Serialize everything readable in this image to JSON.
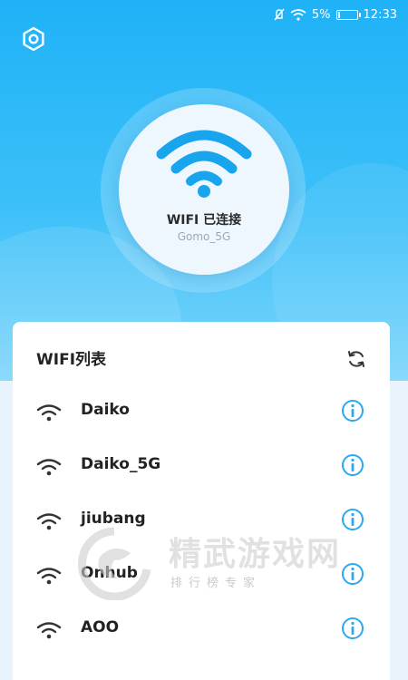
{
  "status_bar": {
    "battery": "5%",
    "time": "12:33",
    "battery_level": 0.05
  },
  "connection": {
    "status": "WIFI 已连接",
    "ssid": "Gomo_5G"
  },
  "list": {
    "title": "WIFI列表",
    "networks": [
      {
        "name": "Daiko"
      },
      {
        "name": "Daiko_5G"
      },
      {
        "name": "jiubang"
      },
      {
        "name": "Onhub"
      },
      {
        "name": "AOO"
      }
    ]
  },
  "watermark": {
    "title": "精武游戏网",
    "subtitle": "排行榜专家"
  },
  "icons": {
    "settings": "settings-hexagon-icon",
    "refresh": "refresh-icon",
    "wifi": "wifi-icon",
    "info": "info-icon"
  },
  "colors": {
    "accent": "#1fb2f7",
    "info_icon": "#29a9f0",
    "wifi_signal": "#1fa6ef"
  }
}
